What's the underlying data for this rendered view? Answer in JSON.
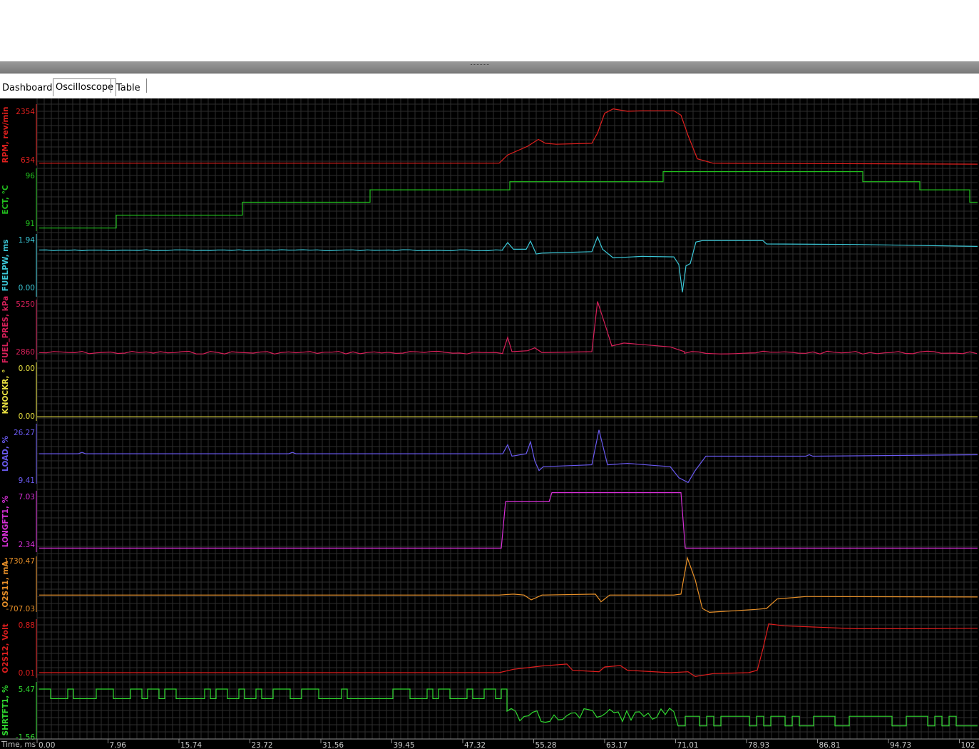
{
  "tabs": [
    {
      "label": "Dashboard",
      "active": false
    },
    {
      "label": "Oscilloscope",
      "active": true
    },
    {
      "label": "Table",
      "active": false
    }
  ],
  "scope": {
    "background": "#000000",
    "grid_color": "#2e2e2e",
    "axis_title": "Time, ms",
    "time_ticks": [
      "0.00",
      "7.96",
      "15.74",
      "23.72",
      "31.56",
      "39.45",
      "47.32",
      "55.28",
      "63.17",
      "71.01",
      "78.93",
      "86.81",
      "94.73",
      "102"
    ],
    "channels": [
      {
        "name": "RPM, rev/min",
        "color": "#e0201e",
        "max": "2354",
        "min": "634"
      },
      {
        "name": "ECT, °C",
        "color": "#22c01e",
        "max": "96",
        "min": "91"
      },
      {
        "name": "FUELPW, ms",
        "color": "#3cc8d8",
        "max": "1.94",
        "min": "0.00"
      },
      {
        "name": "FUEL_PRES, kPa",
        "color": "#d8205a",
        "max": "5250",
        "min": "2860"
      },
      {
        "name": "KNOCKR, °",
        "color": "#e8e040",
        "max": "0.00",
        "min": "0.00"
      },
      {
        "name": "LOAD, %",
        "color": "#6a5af0",
        "max": "26.27",
        "min": "9.41"
      },
      {
        "name": "LONGFT1, %",
        "color": "#d830d8",
        "max": "7.03",
        "min": "2.34"
      },
      {
        "name": "O2S11, mA",
        "color": "#e89028",
        "max": "1730.47",
        "min": "-707.03"
      },
      {
        "name": "O2S12, Volt",
        "color": "#e01e1e",
        "max": "0.88",
        "min": "0.01"
      },
      {
        "name": "SHRTFT1, %",
        "color": "#30d830",
        "max": "5.47",
        "min": "-1.56"
      }
    ]
  }
}
